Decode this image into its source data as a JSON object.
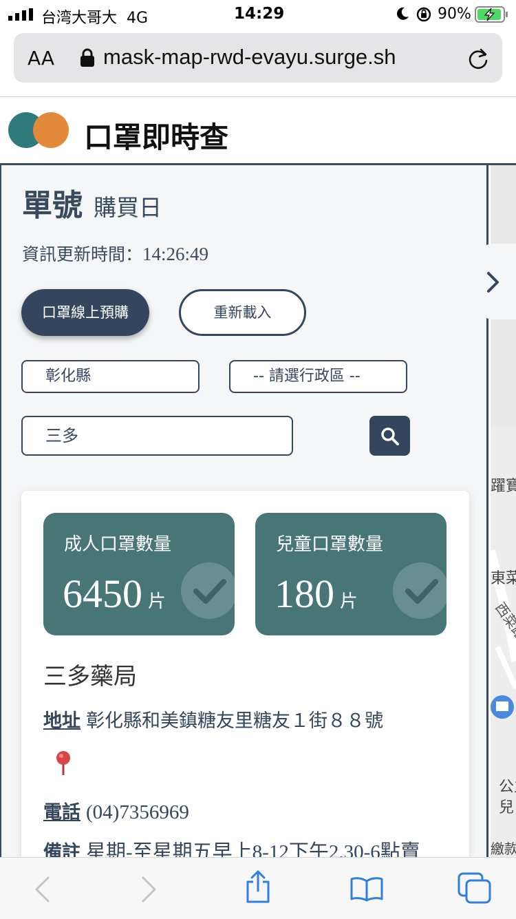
{
  "status_bar": {
    "carrier": "台湾大哥大",
    "network": "4G",
    "time": "14:29",
    "battery": "90%"
  },
  "browser": {
    "text_size": "AA",
    "url": "mask-map-rwd-evayu.surge.sh"
  },
  "header": {
    "title": "口罩即時查"
  },
  "panel": {
    "heading": "單號",
    "subheading": "購買日",
    "update_label": "資訊更新時間：",
    "update_time": "14:26:49",
    "preorder_button": "口罩線上預購",
    "reload_button": "重新載入",
    "county_select": "彰化縣",
    "district_select": "-- 請選行政區 --",
    "search_value": "三多"
  },
  "pharmacy": {
    "adult_label": "成人口罩數量",
    "adult_count": "6450",
    "child_label": "兒童口罩數量",
    "child_count": "180",
    "unit": "片",
    "name": "三多藥局",
    "address_label": "地址",
    "address": "彰化縣和美鎮糖友里糖友１街８８號",
    "phone_label": "電話",
    "phone": "(04)7356969",
    "note_label": "備註",
    "note": "星期-至星期五早上8-12下午2.30-6點賣"
  },
  "colors": {
    "navy": "#34465e",
    "teal": "#487677",
    "orange": "#e08a3a",
    "logo_teal": "#2f7a7b"
  }
}
